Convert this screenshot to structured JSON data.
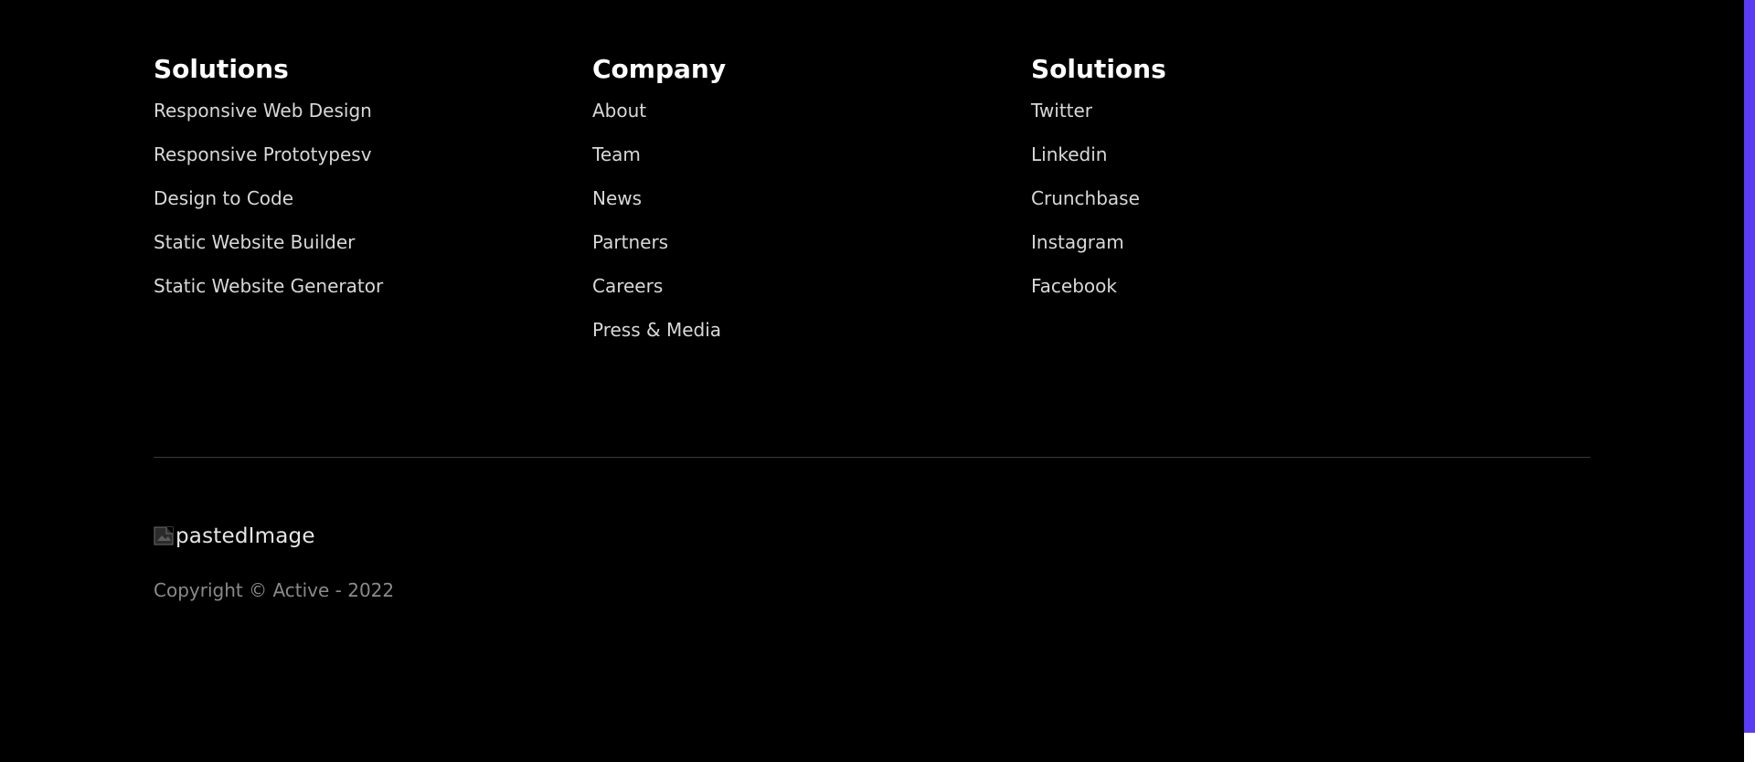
{
  "footer": {
    "columns": [
      {
        "title": "Solutions",
        "links": [
          "Responsive Web Design",
          "Responsive Prototypesv",
          "Design to Code",
          "Static Website Builder",
          "Static Website Generator"
        ]
      },
      {
        "title": "Company",
        "links": [
          "About",
          "Team",
          "News",
          "Partners",
          "Careers",
          "Press & Media"
        ]
      },
      {
        "title": "Solutions",
        "links": [
          "Twitter",
          "Linkedin",
          "Crunchbase",
          "Instagram",
          "Facebook"
        ]
      }
    ],
    "logo": {
      "alt_text": "pastedImage",
      "icon": "broken-image-icon"
    },
    "copyright": "Copyright © Active - 2022"
  },
  "colors": {
    "background": "#000000",
    "heading": "#ffffff",
    "link": "#d8d8d8",
    "copyright": "#8a8a8a",
    "divider": "#3a3a3a",
    "scrollbar_thumb": "#5b3cf5"
  }
}
